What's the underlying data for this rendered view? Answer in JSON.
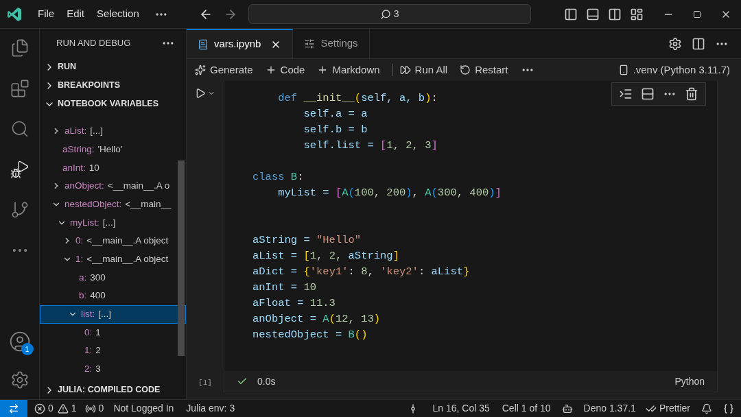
{
  "title_bar": {
    "menu": [
      "File",
      "Edit",
      "Selection"
    ],
    "search": {
      "value": "3"
    }
  },
  "activity_bar": {
    "items": [
      {
        "kind": "explorer",
        "selected": false
      },
      {
        "kind": "extensions",
        "selected": false
      },
      {
        "kind": "search",
        "selected": false
      },
      {
        "kind": "debug",
        "selected": true
      },
      {
        "kind": "source-control",
        "selected": false
      },
      {
        "kind": "more",
        "selected": false
      }
    ],
    "accounts_badge": "1"
  },
  "sidebar": {
    "title": "RUN AND DEBUG",
    "sections": [
      {
        "label": "RUN",
        "expanded": false
      },
      {
        "label": "BREAKPOINTS",
        "expanded": false
      },
      {
        "label": "NOTEBOOK VARIABLES",
        "expanded": true,
        "variables": [
          {
            "name": "aList:",
            "value": "[...]",
            "expanded": false,
            "selected": false
          },
          {
            "name": "aString:",
            "value": "'Hello'",
            "selected": false
          },
          {
            "name": "anInt:",
            "value": "10",
            "selected": false
          },
          {
            "name": "anObject:",
            "value": "<__main__.A o",
            "expanded": false,
            "selected": false
          },
          {
            "name": "nestedObject:",
            "value": "<__main__",
            "expanded": true,
            "selected": false,
            "children": [
              {
                "name": "myList:",
                "value": "[...]",
                "expanded": true,
                "selected": false,
                "children": [
                  {
                    "name": "0:",
                    "value": "<__main__.A object",
                    "expanded": false,
                    "selected": false
                  },
                  {
                    "name": "1:",
                    "value": "<__main__.A object",
                    "expanded": true,
                    "selected": false,
                    "children": [
                      {
                        "name": "a:",
                        "value": "300",
                        "selected": false
                      },
                      {
                        "name": "b:",
                        "value": "400",
                        "selected": false
                      },
                      {
                        "name": "list:",
                        "value": "[...]",
                        "expanded": true,
                        "selected": true,
                        "children": [
                          {
                            "name": "0:",
                            "value": "1",
                            "selected": false
                          },
                          {
                            "name": "1:",
                            "value": "2",
                            "selected": false
                          },
                          {
                            "name": "2:",
                            "value": "3",
                            "selected": false
                          }
                        ]
                      }
                    ]
                  }
                ]
              }
            ]
          }
        ]
      },
      {
        "label": "JULIA: COMPILED CODE",
        "expanded": false
      }
    ]
  },
  "tabs": [
    {
      "label": "vars.ipynb",
      "kind": "notebook",
      "selected": true
    },
    {
      "label": "Settings",
      "kind": "settings",
      "selected": false
    }
  ],
  "notebook_toolbar": {
    "actions": [
      {
        "label": "Generate",
        "kind": "sparkle"
      },
      {
        "label": "Code",
        "kind": "plus"
      },
      {
        "label": "Markdown",
        "kind": "plus"
      },
      {
        "label": "Run All",
        "kind": "run-all"
      },
      {
        "label": "Restart",
        "kind": "restart"
      }
    ],
    "kernel": ".venv (Python 3.11.7)"
  },
  "cell": {
    "execution_count": "[1]",
    "succeeded": true,
    "duration": "0.0s",
    "language": "Python",
    "lines": [
      {
        "kind": "code",
        "tokens": [
          {
            "t": "    def",
            "kind": "keyword"
          },
          {
            "t": " __init__",
            "kind": "function"
          },
          {
            "t": "(",
            "kind": "bracket1"
          },
          {
            "t": "self, a, b",
            "kind": "variable"
          },
          {
            "t": ")",
            "kind": "bracket1"
          },
          {
            "t": ":",
            "kind": "plain"
          }
        ]
      },
      {
        "kind": "code",
        "tokens": [
          {
            "t": "        self.a = a",
            "kind": "variable"
          }
        ]
      },
      {
        "kind": "code",
        "tokens": [
          {
            "t": "        self.b = b",
            "kind": "variable"
          }
        ]
      },
      {
        "kind": "code",
        "tokens": [
          {
            "t": "        self.list = ",
            "kind": "variable"
          },
          {
            "t": "[",
            "kind": "bracket2"
          },
          {
            "t": "1, 2, 3",
            "kind": "number"
          },
          {
            "t": "]",
            "kind": "bracket2"
          }
        ]
      },
      {
        "kind": "blank"
      },
      {
        "kind": "code",
        "tokens": [
          {
            "t": "class",
            "kind": "keyword"
          },
          {
            "t": " B",
            "kind": "class"
          },
          {
            "t": ":",
            "kind": "plain"
          }
        ]
      },
      {
        "kind": "code",
        "tokens": [
          {
            "t": "    myList = ",
            "kind": "variable"
          },
          {
            "t": "[",
            "kind": "bracket2"
          },
          {
            "t": "A",
            "kind": "class"
          },
          {
            "t": "(",
            "kind": "bracket3"
          },
          {
            "t": "100, 200",
            "kind": "number"
          },
          {
            "t": ")",
            "kind": "bracket3"
          },
          {
            "t": ", ",
            "kind": "plain"
          },
          {
            "t": "A",
            "kind": "class"
          },
          {
            "t": "(",
            "kind": "bracket3"
          },
          {
            "t": "300, 400",
            "kind": "number"
          },
          {
            "t": ")",
            "kind": "bracket3"
          },
          {
            "t": "]",
            "kind": "bracket2"
          }
        ]
      },
      {
        "kind": "blank"
      },
      {
        "kind": "blank"
      },
      {
        "kind": "code",
        "tokens": [
          {
            "t": "aString = ",
            "kind": "variable"
          },
          {
            "t": "\"Hello\"",
            "kind": "string"
          }
        ]
      },
      {
        "kind": "code",
        "tokens": [
          {
            "t": "aList = ",
            "kind": "variable"
          },
          {
            "t": "[",
            "kind": "bracket1"
          },
          {
            "t": "1, 2, ",
            "kind": "number"
          },
          {
            "t": "aString",
            "kind": "variable"
          },
          {
            "t": "]",
            "kind": "bracket1"
          }
        ]
      },
      {
        "kind": "code",
        "tokens": [
          {
            "t": "aDict = ",
            "kind": "variable"
          },
          {
            "t": "{",
            "kind": "bracket1"
          },
          {
            "t": "'key1'",
            "kind": "string"
          },
          {
            "t": ": ",
            "kind": "plain"
          },
          {
            "t": "8",
            "kind": "number"
          },
          {
            "t": ", ",
            "kind": "plain"
          },
          {
            "t": "'key2'",
            "kind": "string"
          },
          {
            "t": ": ",
            "kind": "plain"
          },
          {
            "t": "aList",
            "kind": "variable"
          },
          {
            "t": "}",
            "kind": "bracket1"
          }
        ]
      },
      {
        "kind": "code",
        "tokens": [
          {
            "t": "anInt = ",
            "kind": "variable"
          },
          {
            "t": "10",
            "kind": "number"
          }
        ]
      },
      {
        "kind": "code",
        "tokens": [
          {
            "t": "aFloat = ",
            "kind": "variable"
          },
          {
            "t": "11.3",
            "kind": "number"
          }
        ]
      },
      {
        "kind": "code",
        "tokens": [
          {
            "t": "anObject = ",
            "kind": "variable"
          },
          {
            "t": "A",
            "kind": "class"
          },
          {
            "t": "(",
            "kind": "bracket1"
          },
          {
            "t": "12, 13",
            "kind": "number"
          },
          {
            "t": ")",
            "kind": "bracket1"
          }
        ]
      },
      {
        "kind": "code",
        "tokens": [
          {
            "t": "nestedObject = ",
            "kind": "variable"
          },
          {
            "t": "B",
            "kind": "class"
          },
          {
            "t": "()",
            "kind": "bracket1"
          }
        ]
      }
    ]
  },
  "status_bar": {
    "errors": "0",
    "warnings": "1",
    "ports": "0",
    "account": "Not Logged In",
    "julia_env": "Julia env: 3",
    "position": "Ln 16, Col 35",
    "cell": "Cell 1 of 10",
    "runtime": "Deno 1.37.1",
    "formatter": "Prettier"
  }
}
